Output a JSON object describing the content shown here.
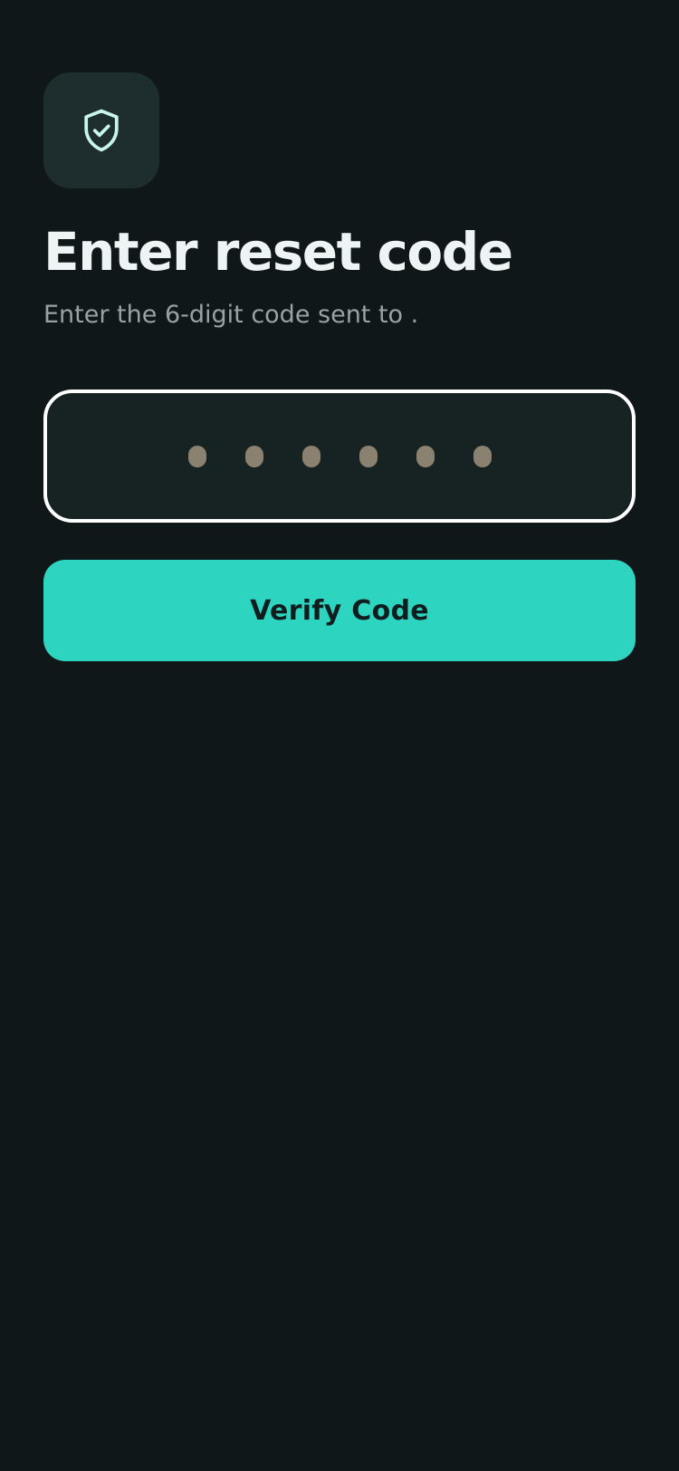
{
  "header": {
    "icon": "shield-check-icon",
    "title": "Enter reset code",
    "subtitle": "Enter the 6-digit code sent to ."
  },
  "code_input": {
    "digit_count": 6,
    "value": "",
    "placeholder_glyph": "dot"
  },
  "actions": {
    "verify_label": "Verify Code"
  },
  "colors": {
    "background": "#0f1719",
    "icon_tile": "#1e2e2f",
    "icon_stroke": "#c8f5ee",
    "accent": "#2dd4bf",
    "title_text": "#eef4f3",
    "subtitle_text": "#98a3a2",
    "input_border": "#ffffff",
    "input_fill": "#172223",
    "placeholder_dot": "#8b8171"
  }
}
